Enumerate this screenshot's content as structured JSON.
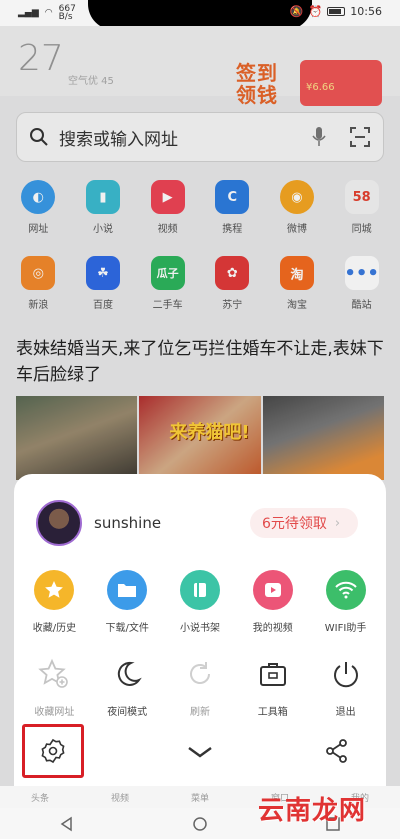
{
  "status_bar": {
    "network_speed": "667\nB/s",
    "time": "10:56"
  },
  "banner": {
    "weather_number": "27",
    "weather_text": "空气优 45",
    "promo_title_1": "签到",
    "promo_title_2": "领钱",
    "promo_amount": "¥6.66"
  },
  "search": {
    "placeholder": "搜索或输入网址"
  },
  "shortcuts_row1": [
    {
      "label": "网址",
      "icon": "globe-icon",
      "color": "#3a9be8"
    },
    {
      "label": "小说",
      "icon": "book-icon",
      "color": "#3cbcd1"
    },
    {
      "label": "视频",
      "icon": "video-icon",
      "color": "#ee4455"
    },
    {
      "label": "携程",
      "icon": "ctrip-icon",
      "color": "#2d7de0"
    },
    {
      "label": "微博",
      "icon": "weibo-icon",
      "color": "#f5a623"
    },
    {
      "label": "同城",
      "icon": "58-icon",
      "color": "#f4f4f4"
    }
  ],
  "shortcuts_row2": [
    {
      "label": "新浪",
      "icon": "sina-icon",
      "color": "#f48a2c"
    },
    {
      "label": "百度",
      "icon": "baidu-icon",
      "color": "#2f6be6"
    },
    {
      "label": "二手车",
      "icon": "guazi-icon",
      "color": "#2db55d"
    },
    {
      "label": "苏宁",
      "icon": "suning-icon",
      "color": "#e23a3a"
    },
    {
      "label": "淘宝",
      "icon": "taobao-icon",
      "color": "#f46b1f"
    },
    {
      "label": "酷站",
      "icon": "more-icon",
      "color": "#ffffff"
    }
  ],
  "headline": "表妹结婚当天,来了位乞丐拦住婚车不让走,表妹下车后脸绿了",
  "thumb_overlay": "来养猫吧!",
  "sheet": {
    "username": "sunshine",
    "coupon": "6元待领取",
    "row1": [
      {
        "label": "收藏/历史",
        "icon": "star-icon",
        "color": "#f5b62a"
      },
      {
        "label": "下载/文件",
        "icon": "folder-icon",
        "color": "#3c9be9"
      },
      {
        "label": "小说书架",
        "icon": "bookshelf-icon",
        "color": "#3cc4a6"
      },
      {
        "label": "我的视频",
        "icon": "play-icon",
        "color": "#ec5577"
      },
      {
        "label": "WIFI助手",
        "icon": "wifi-icon",
        "color": "#3cbe6a"
      }
    ],
    "row2": [
      {
        "label": "收藏网址",
        "icon": "star-add-icon"
      },
      {
        "label": "夜间模式",
        "icon": "moon-icon"
      },
      {
        "label": "刷新",
        "icon": "refresh-icon"
      },
      {
        "label": "工具箱",
        "icon": "toolbox-icon"
      },
      {
        "label": "退出",
        "icon": "power-icon"
      }
    ]
  },
  "tabbar": [
    "头条",
    "视频",
    "菜单",
    "窗口",
    "我的"
  ],
  "watermark": "云南龙网"
}
